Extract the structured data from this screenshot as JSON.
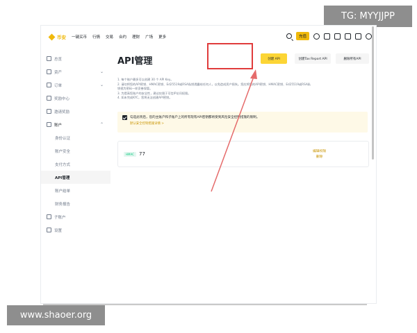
{
  "watermarks": {
    "tg": "TG: MYYJJPP",
    "site": "www.shaoer.org"
  },
  "topbar": {
    "brand": "币安",
    "nav": [
      "一键买币",
      "行情",
      "交易",
      "合约",
      "理财",
      "广场",
      "更多"
    ],
    "deposit_label": "充值"
  },
  "sidebar": {
    "items": [
      {
        "label": "总览",
        "icon": "home-icon",
        "chevron": ""
      },
      {
        "label": "资产",
        "icon": "wallet-icon",
        "chevron": "⌄"
      },
      {
        "label": "订单",
        "icon": "order-icon",
        "chevron": "⌄"
      },
      {
        "label": "奖励中心",
        "icon": "reward-icon",
        "chevron": ""
      },
      {
        "label": "邀请奖励",
        "icon": "invite-icon",
        "chevron": ""
      },
      {
        "label": "账户",
        "icon": "user-icon",
        "chevron": "⌃"
      }
    ],
    "account_sub": [
      "身份认证",
      "账户安全",
      "支付方式",
      "API管理",
      "账户结单",
      "财务报告"
    ],
    "active": "API管理",
    "bottom": [
      {
        "label": "子账户",
        "icon": "subaccount-icon"
      },
      {
        "label": "设置",
        "icon": "settings-icon"
      }
    ]
  },
  "main": {
    "title": "API管理",
    "buttons": {
      "create": "创建 API",
      "tax": "创建Tax Report API",
      "delete_all": "删除所有API"
    },
    "notes": [
      "1. 每个账户最多可以创建 30 个 API Key。",
      "2. 请勿将您的API密钥、HMAC密钥、Ed25519或RSA私钥透露给任何人，以免造成资产损失。您应将您的API密钥、HMAC密钥、Ed25519或RSA私",
      "钥视为密码一样妥善保管。",
      "3. 为提高您账户的安全性，建议仅限于可信IP访问权限。",
      "4. 如未完成KYC，您将无法创建API密钥。"
    ],
    "alert": {
      "text": "勾选此项后，您的主账户和子账户上的所有现有API密钥都将受到风险安全控制措施的限制。",
      "link": "默认安全控制措施详情 >"
    },
    "api_card": {
      "tag": "HMAC",
      "name": "77",
      "action_edit": "编辑权限",
      "action_delete": "删除"
    }
  },
  "annotation": {
    "highlight_color": "#e03b3b"
  }
}
